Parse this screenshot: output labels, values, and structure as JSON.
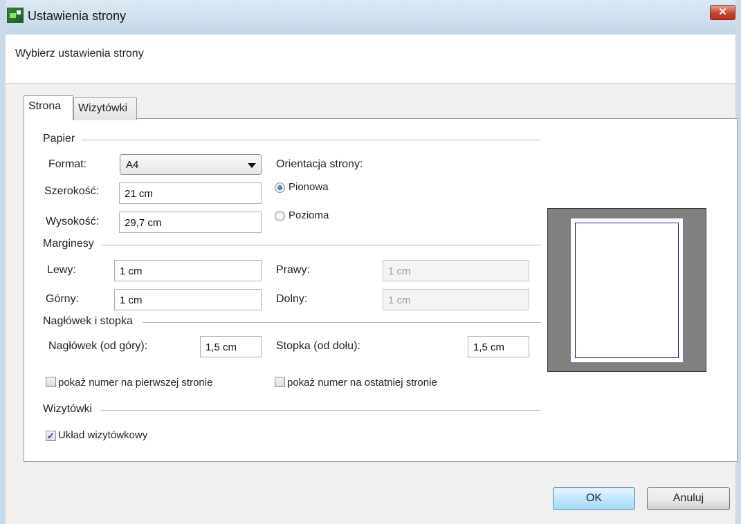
{
  "window": {
    "title": "Ustawienia strony",
    "close_symbol": "✕",
    "subtitle": "Wybierz ustawienia strony"
  },
  "tabs": [
    {
      "label": "Strona",
      "active": true
    },
    {
      "label": "Wizytówki",
      "active": false
    }
  ],
  "paper": {
    "group_label": "Papier",
    "format_label": "Format:",
    "format_value": "A4",
    "width_label": "Szerokość:",
    "width_value": "21 cm",
    "height_label": "Wysokość:",
    "height_value": "29,7 cm",
    "orientation_label": "Orientacja strony:",
    "portrait_label": "Pionowa",
    "portrait_checked": true,
    "landscape_label": "Pozioma",
    "landscape_checked": false
  },
  "margins": {
    "group_label": "Marginesy",
    "left_label": "Lewy:",
    "left_value": "1 cm",
    "right_label": "Prawy:",
    "right_value": "1 cm",
    "top_label": "Górny:",
    "top_value": "1 cm",
    "bottom_label": "Dolny:",
    "bottom_value": "1 cm"
  },
  "header_footer": {
    "group_label": "Nagłówek i stopka",
    "header_label": "Nagłówek (od góry):",
    "header_value": "1,5 cm",
    "footer_label": "Stopka (od dołu):",
    "footer_value": "1,5 cm",
    "show_first_label": "pokaż numer na pierwszej stronie",
    "show_first_checked": false,
    "show_last_label": "pokaż numer na ostatniej stronie",
    "show_last_checked": false
  },
  "cards": {
    "group_label": "Wizytówki",
    "layout_label": "Układ wizytówkowy",
    "layout_checked": true,
    "check_glyph": "✓"
  },
  "buttons": {
    "ok_label": "OK",
    "cancel_label": "Anuluj"
  },
  "colors": {
    "preview_background": "#808080",
    "margin_outline": "#1d1d8a",
    "ok_button_accent": "#3c7fb1"
  }
}
